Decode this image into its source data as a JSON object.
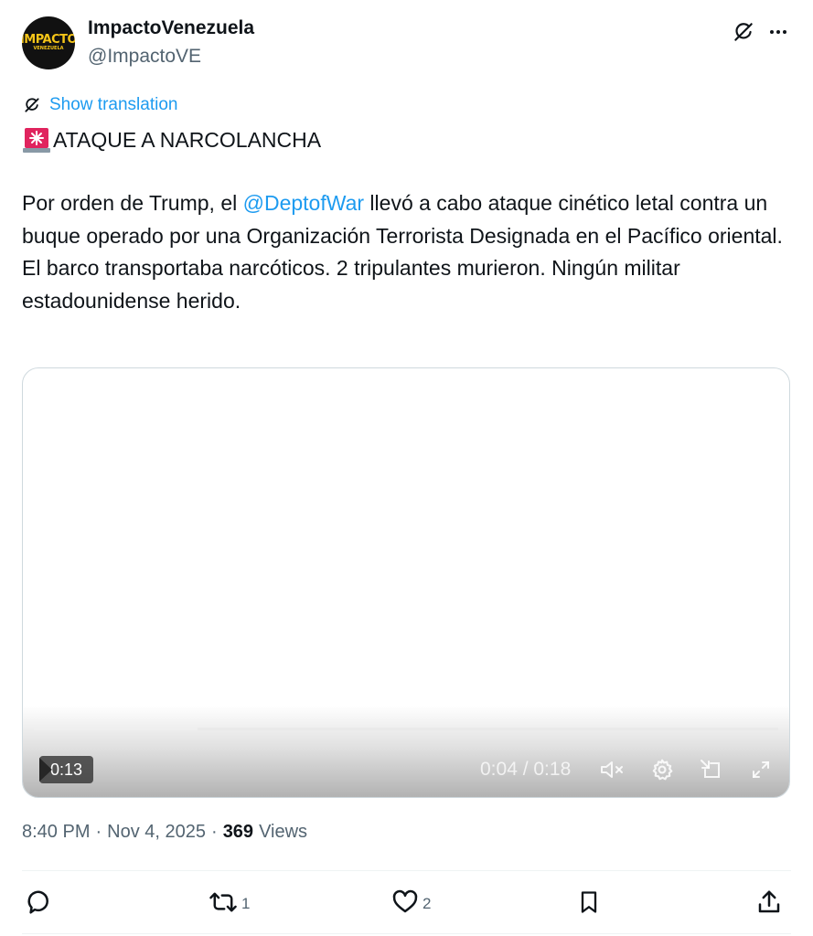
{
  "author": {
    "display_name": "ImpactoVenezuela",
    "handle": "@ImpactoVE",
    "avatar_text_main": "IMPACTO",
    "avatar_text_sub": "VENEZUELA"
  },
  "translation": {
    "label": "Show translation"
  },
  "tweet": {
    "headline": "ATAQUE A NARCOLANCHA",
    "body_prefix": "Por orden de Trump, el ",
    "mention": "@DeptofWar",
    "body_after_mention": " llevó a cabo ataque cinético letal contra un buque operado por una Organización Terrorista Designada en el Pacífico oriental.",
    "body_line2": "El barco transportaba narcóticos. 2 tripulantes murieron. Ningún militar estadounidense herido."
  },
  "video": {
    "duration_badge": "0:13",
    "timecode": "0:04 / 0:18",
    "progress_fraction": 0.22
  },
  "meta": {
    "time": "8:40 PM",
    "separator": "·",
    "date": "Nov 4, 2025",
    "views_count": "369",
    "views_label": "Views"
  },
  "actions": {
    "reply_count": "",
    "retweet_count": "1",
    "like_count": "2"
  },
  "colors": {
    "accent": "#1d9bf0",
    "text_primary": "#0f1419",
    "text_secondary": "#536471",
    "border": "#cfd9de"
  },
  "icons": {
    "grok": "grok-icon",
    "more": "more-icon",
    "translate": "translate-icon",
    "siren": "siren-emoji-icon",
    "mute": "mute-icon",
    "settings": "gear-icon",
    "pip": "picture-in-picture-icon",
    "fullscreen": "fullscreen-icon",
    "reply": "reply-icon",
    "retweet": "retweet-icon",
    "like": "heart-icon",
    "bookmark": "bookmark-icon",
    "share": "share-icon"
  }
}
